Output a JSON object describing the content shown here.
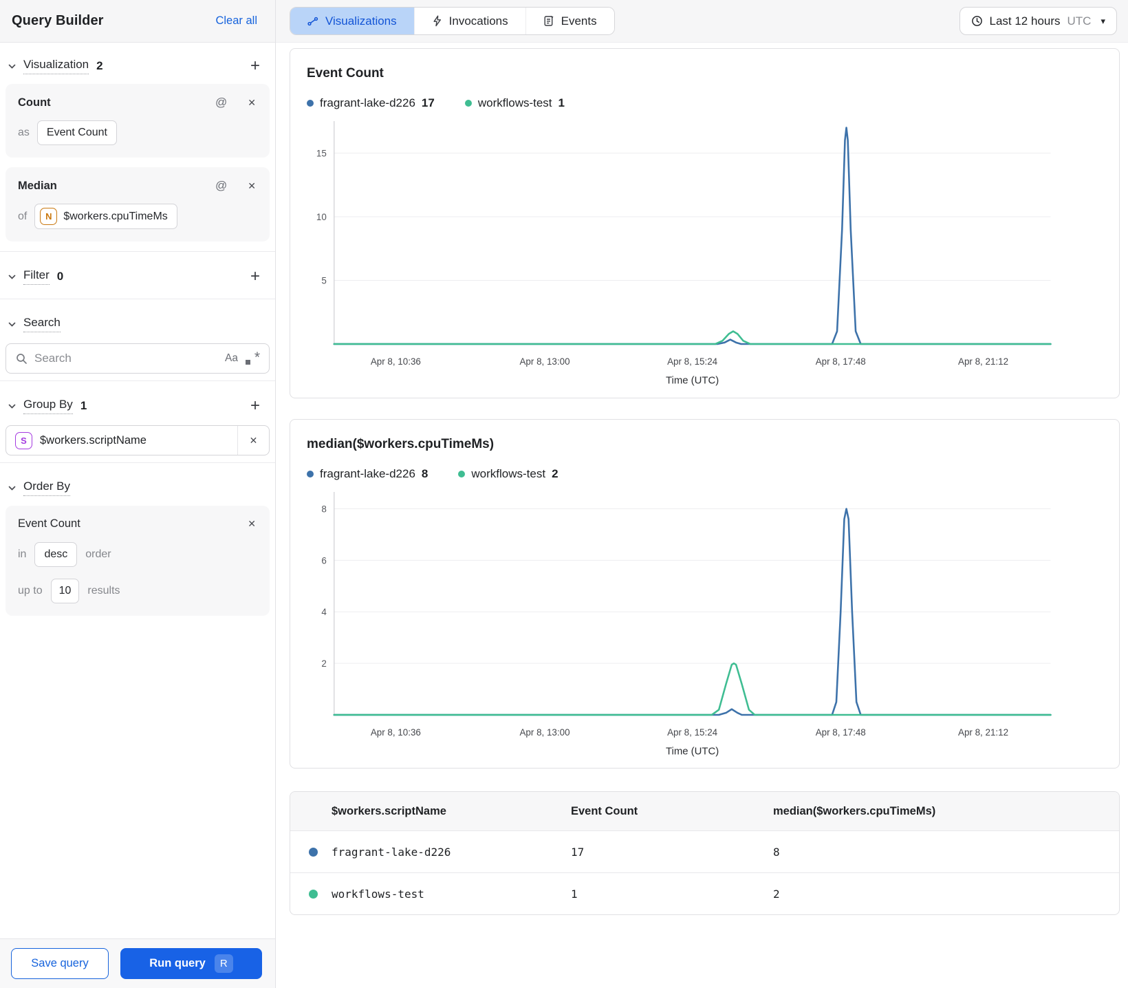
{
  "icons": {
    "plus": "+",
    "close": "✕",
    "at": "@",
    "caret": "▾"
  },
  "sidebar": {
    "title": "Query Builder",
    "clear_all": "Clear all",
    "sections": {
      "visualization": {
        "label": "Visualization",
        "count": "2"
      },
      "filter": {
        "label": "Filter",
        "count": "0"
      },
      "search": {
        "label": "Search"
      },
      "group_by": {
        "label": "Group By",
        "count": "1"
      },
      "order_by": {
        "label": "Order By"
      }
    },
    "visualizations": [
      {
        "name": "Count",
        "prefix": "as",
        "value": "Event Count"
      },
      {
        "name": "Median",
        "prefix": "of",
        "field_type": "N",
        "value": "$workers.cpuTimeMs"
      }
    ],
    "search_placeholder": "Search",
    "match_case_label": "Aa",
    "group_by_field": {
      "type": "S",
      "value": "$workers.scriptName"
    },
    "order_by": {
      "field": "Event Count",
      "in_label": "in",
      "direction": "desc",
      "order_label": "order",
      "up_to_label": "up to",
      "limit": "10",
      "results_label": "results"
    },
    "save_button": "Save query",
    "run_button": "Run query",
    "run_shortcut": "R"
  },
  "toolbar": {
    "tabs": [
      {
        "label": "Visualizations",
        "active": true
      },
      {
        "label": "Invocations",
        "active": false
      },
      {
        "label": "Events",
        "active": false
      }
    ],
    "time_range": {
      "label": "Last 12 hours",
      "timezone": "UTC"
    }
  },
  "chart_data": [
    {
      "type": "line",
      "title": "Event Count",
      "xlabel": "Time (UTC)",
      "ylim": [
        0,
        17.3
      ],
      "y_ticks": [
        5,
        10,
        15
      ],
      "x_ticks": [
        {
          "label": "Apr 8, 10:36",
          "frac": 0.086
        },
        {
          "label": "Apr 8, 13:00",
          "frac": 0.294
        },
        {
          "label": "Apr 8, 15:24",
          "frac": 0.5
        },
        {
          "label": "Apr 8, 17:48",
          "frac": 0.707
        },
        {
          "label": "Apr 8, 21:12",
          "frac": 0.906
        }
      ],
      "legend": [
        {
          "name": "fragrant-lake-d226",
          "value": "17",
          "color": "#3d72aa"
        },
        {
          "name": "workflows-test",
          "value": "1",
          "color": "#3fbd92"
        }
      ],
      "series": [
        {
          "name": "fragrant-lake-d226",
          "color": "#3d72aa",
          "points": [
            [
              0,
              0
            ],
            [
              0.535,
              0
            ],
            [
              0.545,
              0.12
            ],
            [
              0.553,
              0.35
            ],
            [
              0.561,
              0.12
            ],
            [
              0.568,
              0
            ],
            [
              0.695,
              0
            ],
            [
              0.702,
              1
            ],
            [
              0.709,
              9
            ],
            [
              0.713,
              16
            ],
            [
              0.715,
              17
            ],
            [
              0.717,
              16
            ],
            [
              0.721,
              9
            ],
            [
              0.728,
              1
            ],
            [
              0.735,
              0
            ],
            [
              1,
              0
            ]
          ]
        },
        {
          "name": "workflows-test",
          "color": "#3fbd92",
          "points": [
            [
              0,
              0
            ],
            [
              0.532,
              0
            ],
            [
              0.542,
              0.25
            ],
            [
              0.551,
              0.8
            ],
            [
              0.557,
              1
            ],
            [
              0.563,
              0.8
            ],
            [
              0.571,
              0.25
            ],
            [
              0.581,
              0
            ],
            [
              1,
              0
            ]
          ]
        }
      ]
    },
    {
      "type": "line",
      "title": "median($workers.cpuTimeMs)",
      "xlabel": "Time (UTC)",
      "ylim": [
        0,
        8.55
      ],
      "y_ticks": [
        2,
        4,
        6,
        8
      ],
      "x_ticks": [
        {
          "label": "Apr 8, 10:36",
          "frac": 0.086
        },
        {
          "label": "Apr 8, 13:00",
          "frac": 0.294
        },
        {
          "label": "Apr 8, 15:24",
          "frac": 0.5
        },
        {
          "label": "Apr 8, 17:48",
          "frac": 0.707
        },
        {
          "label": "Apr 8, 21:12",
          "frac": 0.906
        }
      ],
      "legend": [
        {
          "name": "fragrant-lake-d226",
          "value": "8",
          "color": "#3d72aa"
        },
        {
          "name": "workflows-test",
          "value": "2",
          "color": "#3fbd92"
        }
      ],
      "series": [
        {
          "name": "fragrant-lake-d226",
          "color": "#3d72aa",
          "points": [
            [
              0,
              0
            ],
            [
              0.537,
              0
            ],
            [
              0.547,
              0.08
            ],
            [
              0.555,
              0.22
            ],
            [
              0.563,
              0.08
            ],
            [
              0.569,
              0
            ],
            [
              0.695,
              0
            ],
            [
              0.701,
              0.5
            ],
            [
              0.707,
              4
            ],
            [
              0.712,
              7.6
            ],
            [
              0.715,
              8
            ],
            [
              0.718,
              7.6
            ],
            [
              0.723,
              4
            ],
            [
              0.729,
              0.5
            ],
            [
              0.735,
              0
            ],
            [
              1,
              0
            ]
          ]
        },
        {
          "name": "workflows-test",
          "color": "#3fbd92",
          "points": [
            [
              0,
              0
            ],
            [
              0.527,
              0
            ],
            [
              0.537,
              0.2
            ],
            [
              0.547,
              1.2
            ],
            [
              0.555,
              1.95
            ],
            [
              0.558,
              2
            ],
            [
              0.561,
              1.95
            ],
            [
              0.569,
              1.2
            ],
            [
              0.579,
              0.2
            ],
            [
              0.587,
              0
            ],
            [
              1,
              0
            ]
          ]
        }
      ]
    }
  ],
  "table": {
    "columns": [
      "$workers.scriptName",
      "Event Count",
      "median($workers.cpuTimeMs)"
    ],
    "rows": [
      {
        "color": "#3d72aa",
        "cells": [
          "fragrant-lake-d226",
          "17",
          "8"
        ]
      },
      {
        "color": "#3fbd92",
        "cells": [
          "workflows-test",
          "1",
          "2"
        ]
      }
    ]
  }
}
